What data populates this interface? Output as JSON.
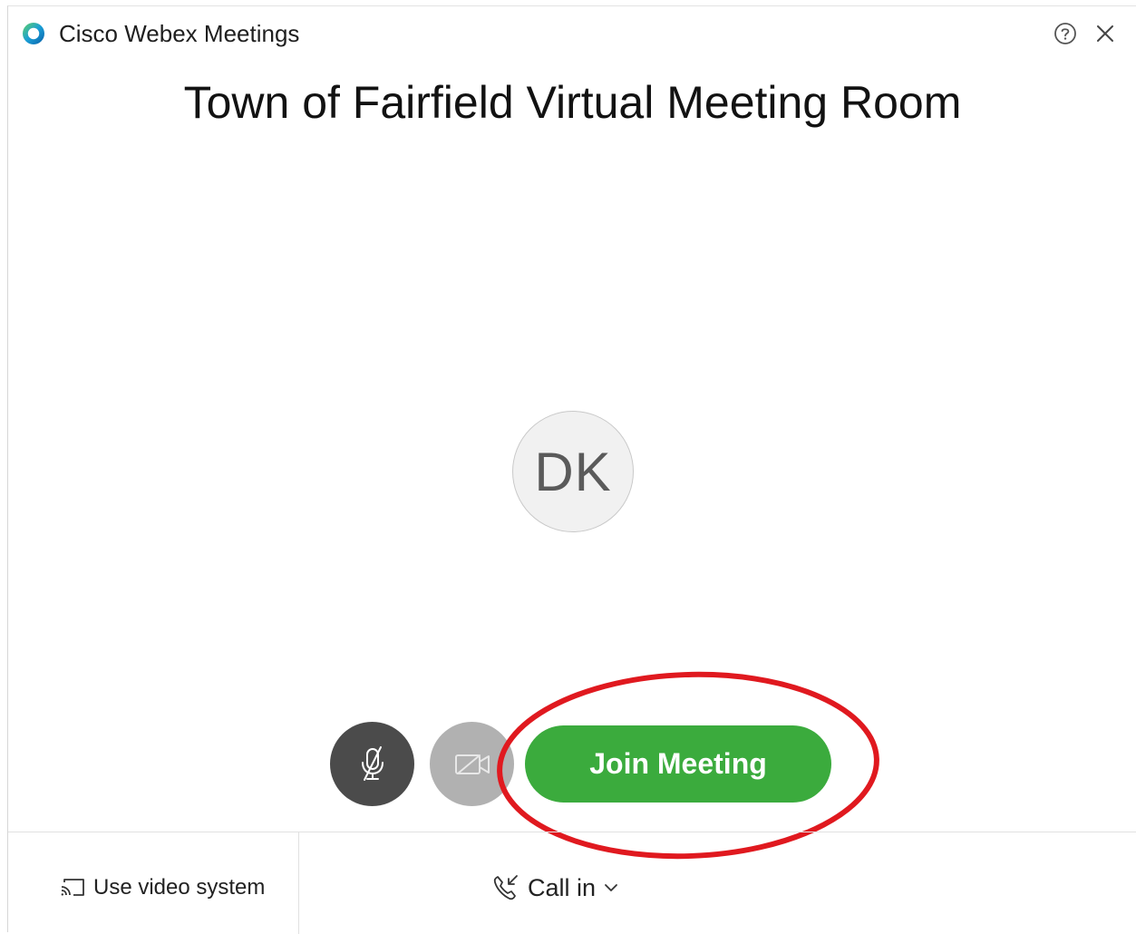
{
  "app": {
    "title": "Cisco Webex Meetings",
    "logo_icon": "webex-logo-icon"
  },
  "titlebar": {
    "help_icon": "help-icon",
    "close_icon": "close-icon"
  },
  "meeting": {
    "title": "Town of Fairfield Virtual Meeting Room"
  },
  "avatar": {
    "initials": "DK"
  },
  "controls": {
    "mute_icon": "microphone-muted-icon",
    "video_icon": "video-off-icon",
    "join_label": "Join Meeting"
  },
  "footer": {
    "video_system_label": "Use video system",
    "video_system_icon": "cast-icon",
    "call_in_label": "Call in",
    "call_in_icon": "phone-incoming-icon",
    "call_in_chevron": "chevron-down-icon"
  },
  "colors": {
    "join_green": "#3bab3d",
    "mute_dark": "#4b4b4b",
    "video_grey": "#b1b1b1",
    "annotation_red": "#e0191f"
  }
}
